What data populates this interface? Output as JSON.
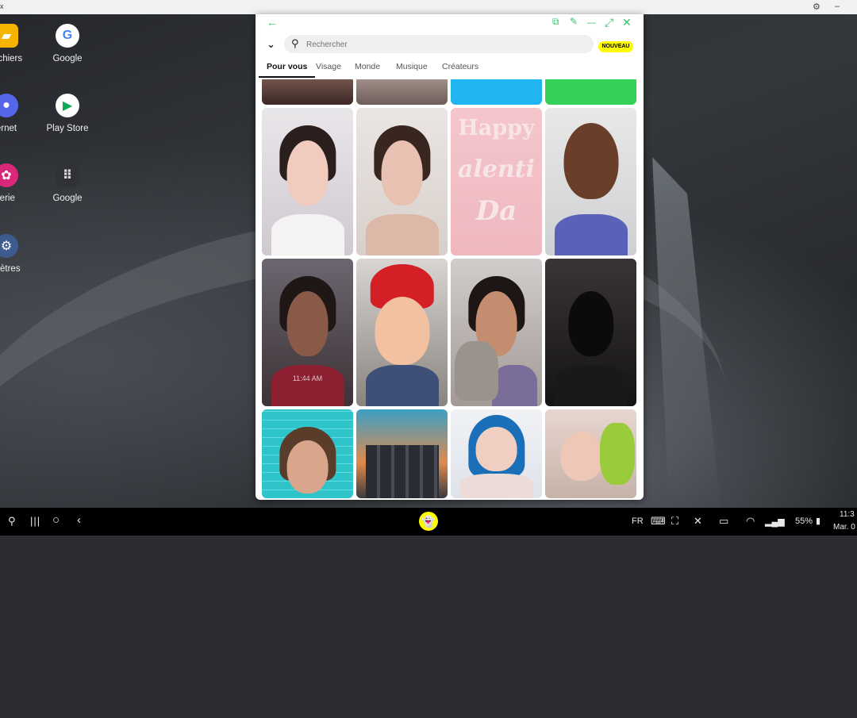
{
  "topbar": {
    "title": "x",
    "gear": "⚙",
    "minimize": "–"
  },
  "desktop": {
    "icons": [
      {
        "label": "Fichiers",
        "glyph": "▰",
        "color": "#f5b400",
        "name": "files-icon"
      },
      {
        "label": "Google",
        "glyph": "G",
        "color": "#ffffff",
        "name": "google-icon"
      },
      {
        "label": "ernet",
        "glyph": "●",
        "color": "#5567e8",
        "name": "internet-icon"
      },
      {
        "label": "Play Store",
        "glyph": "▶",
        "color": "#ffffff",
        "name": "play-store-icon"
      },
      {
        "label": "lerie",
        "glyph": "✿",
        "color": "#d9287a",
        "name": "gallery-icon"
      },
      {
        "label": "Google",
        "glyph": "⠿",
        "color": "#303236",
        "name": "google-folder-icon"
      },
      {
        "label": "mètres",
        "glyph": "⚙",
        "color": "#3e5b8f",
        "name": "settings-icon"
      }
    ]
  },
  "snap": {
    "controls": {
      "back": "←",
      "sticker": "⧉",
      "pin": "✎",
      "minimize": "—",
      "expand": "⤢",
      "close": "✕"
    },
    "collapse": "⌄",
    "search_icon": "⚲",
    "search_placeholder": "Rechercher",
    "new_badge": "NOUVEAU",
    "tabs": [
      "Pour vous",
      "Visage",
      "Monde",
      "Musique",
      "Créateurs"
    ],
    "tiles_text": {
      "happy": "Happy",
      "valentine": "alenti",
      "day": "Da",
      "clock": "11:44 AM"
    }
  },
  "taskbar": {
    "language": "FR",
    "battery": "55%",
    "clock": "11:3",
    "date": "Mar. 0"
  }
}
